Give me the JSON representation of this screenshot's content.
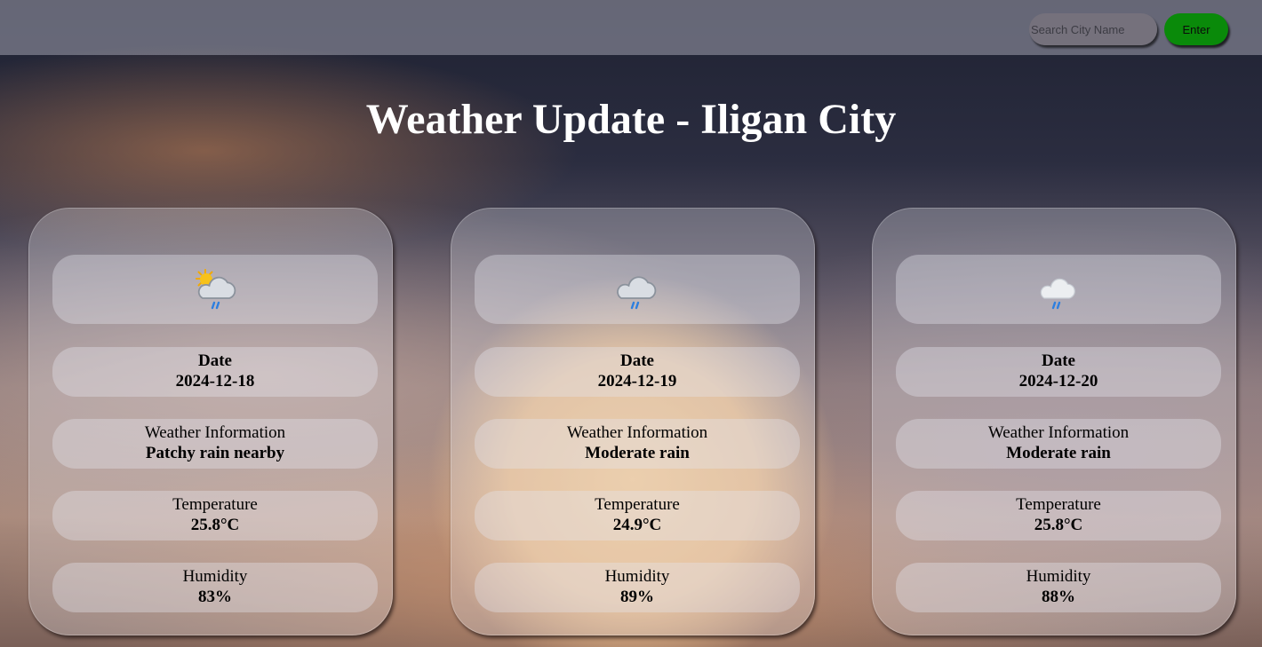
{
  "search": {
    "placeholder": "Search City Name",
    "button_label": "Enter"
  },
  "colors": {
    "enter_button": "#0a8a0a",
    "title": "#ffffff"
  },
  "page_title": "Weather Update - Iligan City",
  "cards": [
    {
      "icon": "sun-cloud-rain-icon",
      "date_label": "Date",
      "date": "2024-12-18",
      "weather_label": "Weather Information",
      "weather": "Patchy rain nearby",
      "temperature_label": "Temperature",
      "temperature": "25.8°C",
      "humidity_label": "Humidity",
      "humidity": "83%"
    },
    {
      "icon": "cloud-rain-icon",
      "date_label": "Date",
      "date": "2024-12-19",
      "weather_label": "Weather Information",
      "weather": "Moderate rain",
      "temperature_label": "Temperature",
      "temperature": "24.9°C",
      "humidity_label": "Humidity",
      "humidity": "89%"
    },
    {
      "icon": "cloud-rain-icon",
      "date_label": "Date",
      "date": "2024-12-20",
      "weather_label": "Weather Information",
      "weather": "Moderate rain",
      "temperature_label": "Temperature",
      "temperature": "25.8°C",
      "humidity_label": "Humidity",
      "humidity": "88%"
    }
  ]
}
